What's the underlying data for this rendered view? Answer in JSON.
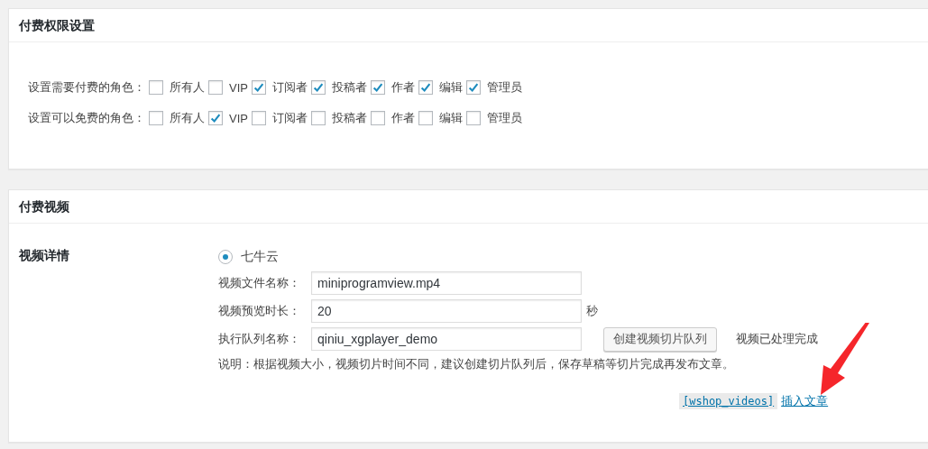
{
  "permissions_panel": {
    "title": "付费权限设置",
    "rows": [
      {
        "label": "设置需要付费的角色：",
        "roles": [
          {
            "name": "所有人",
            "checked": false
          },
          {
            "name": "VIP",
            "checked": false
          },
          {
            "name": "订阅者",
            "checked": true
          },
          {
            "name": "投稿者",
            "checked": true
          },
          {
            "name": "作者",
            "checked": true
          },
          {
            "name": "编辑",
            "checked": true
          },
          {
            "name": "管理员",
            "checked": true
          }
        ]
      },
      {
        "label": "设置可以免费的角色：",
        "roles": [
          {
            "name": "所有人",
            "checked": false
          },
          {
            "name": "VIP",
            "checked": true
          },
          {
            "name": "订阅者",
            "checked": false
          },
          {
            "name": "投稿者",
            "checked": false
          },
          {
            "name": "作者",
            "checked": false
          },
          {
            "name": "编辑",
            "checked": false
          },
          {
            "name": "管理员",
            "checked": false
          }
        ]
      }
    ]
  },
  "video_panel": {
    "title": "付费视频",
    "section_label": "视频详情",
    "provider": {
      "label": "七牛云",
      "selected": true
    },
    "fields": [
      {
        "label": "视频文件名称：",
        "value": "miniprogramview.mp4"
      },
      {
        "label": "视频预览时长：",
        "value": "20",
        "suffix": "秒"
      },
      {
        "label": "执行队列名称：",
        "value": "qiniu_xgplayer_demo",
        "button": "创建视频切片队列",
        "status": "视频已处理完成"
      }
    ],
    "note": "说明：根据视频大小，视频切片时间不同，建议创建切片队列后，保存草稿等切片完成再发布文章。",
    "shortcode": "[wshop_videos]",
    "insert_link": "插入文章"
  }
}
